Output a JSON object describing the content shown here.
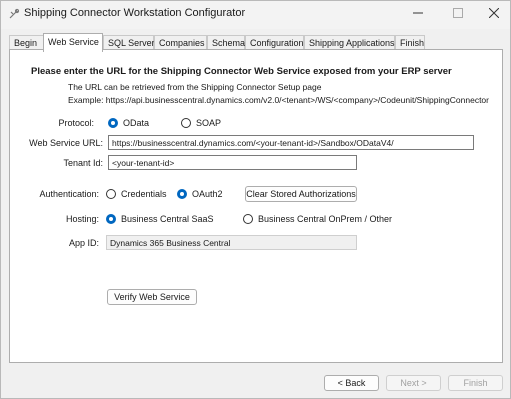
{
  "window": {
    "title": "Shipping Connector Workstation Configurator",
    "min_icon": "minimize-icon",
    "max_icon": "maximize-icon",
    "close_icon": "close-icon"
  },
  "tabs": [
    {
      "label": "Begin",
      "active": false
    },
    {
      "label": "Web Service",
      "active": true
    },
    {
      "label": "SQL Server",
      "active": false
    },
    {
      "label": "Companies",
      "active": false
    },
    {
      "label": "Schema",
      "active": false
    },
    {
      "label": "Configuration",
      "active": false
    },
    {
      "label": "Shipping Applications",
      "active": false
    },
    {
      "label": "Finish",
      "active": false
    }
  ],
  "content": {
    "heading": "Please enter the URL for the Shipping Connector Web Service exposed from your ERP server",
    "hint": "The URL can be retrieved from the Shipping Connector Setup page",
    "example": "Example:  https://api.businesscentral.dynamics.com/v2.0/<tenant>/WS/<company>/Codeunit/ShippingConnector",
    "protocol": {
      "label": "Protocol:",
      "options": [
        "OData",
        "SOAP"
      ],
      "selected": "OData"
    },
    "url": {
      "label": "Web Service URL:",
      "value": "https://businesscentral.dynamics.com/<your-tenant-id>/Sandbox/ODataV4/"
    },
    "tenant": {
      "label": "Tenant Id:",
      "value": "<your-tenant-id>"
    },
    "authentication": {
      "label": "Authentication:",
      "options": [
        "Credentials",
        "OAuth2"
      ],
      "selected": "OAuth2",
      "clear_button": "Clear Stored Authorizations"
    },
    "hosting": {
      "label": "Hosting:",
      "options": [
        "Business Central SaaS",
        "Business Central OnPrem / Other"
      ],
      "selected": "Business Central SaaS"
    },
    "app_id": {
      "label": "App ID:",
      "value": "Dynamics 365 Business Central"
    },
    "verify_button": "Verify Web Service"
  },
  "footer": {
    "back": "< Back",
    "next": "Next >",
    "finish": "Finish"
  }
}
